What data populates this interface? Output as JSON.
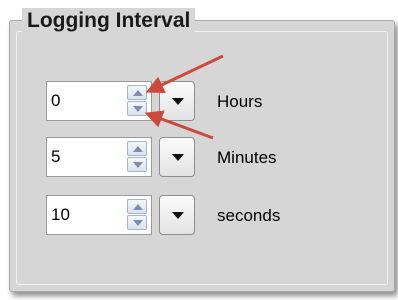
{
  "panel": {
    "title": "Logging Interval"
  },
  "rows": [
    {
      "value": "0",
      "unit": "Hours"
    },
    {
      "value": "5",
      "unit": "Minutes"
    },
    {
      "value": "10",
      "unit": "seconds"
    }
  ],
  "icons": {
    "spin_up": "triangle-up-icon",
    "spin_down": "triangle-down-icon",
    "dropdown": "chevron-down-icon",
    "annotation": "red-arrow-icon"
  },
  "colors": {
    "panel_bg": "#d6d6d6",
    "annotation_arrow": "#cc4a3c",
    "spinner_arrow": "#7b8fb0"
  }
}
